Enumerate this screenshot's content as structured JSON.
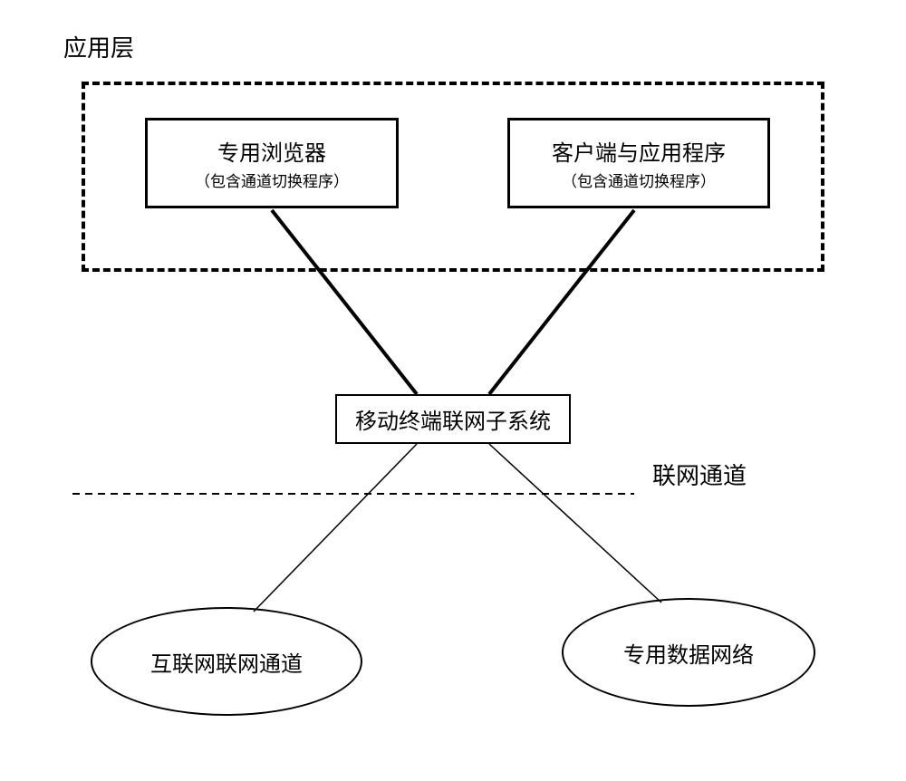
{
  "labels": {
    "appLayer": "应用层",
    "networkChannel": "联网通道"
  },
  "boxes": {
    "browser": {
      "title": "专用浏览器",
      "subtitle": "（包含通道切换程序）"
    },
    "client": {
      "title": "客户端与应用程序",
      "subtitle": "（包含通道切换程序）"
    },
    "subsystem": "移动终端联网子系统"
  },
  "ellipses": {
    "internet": "互联网联网通道",
    "dedicated": "专用数据网络"
  }
}
